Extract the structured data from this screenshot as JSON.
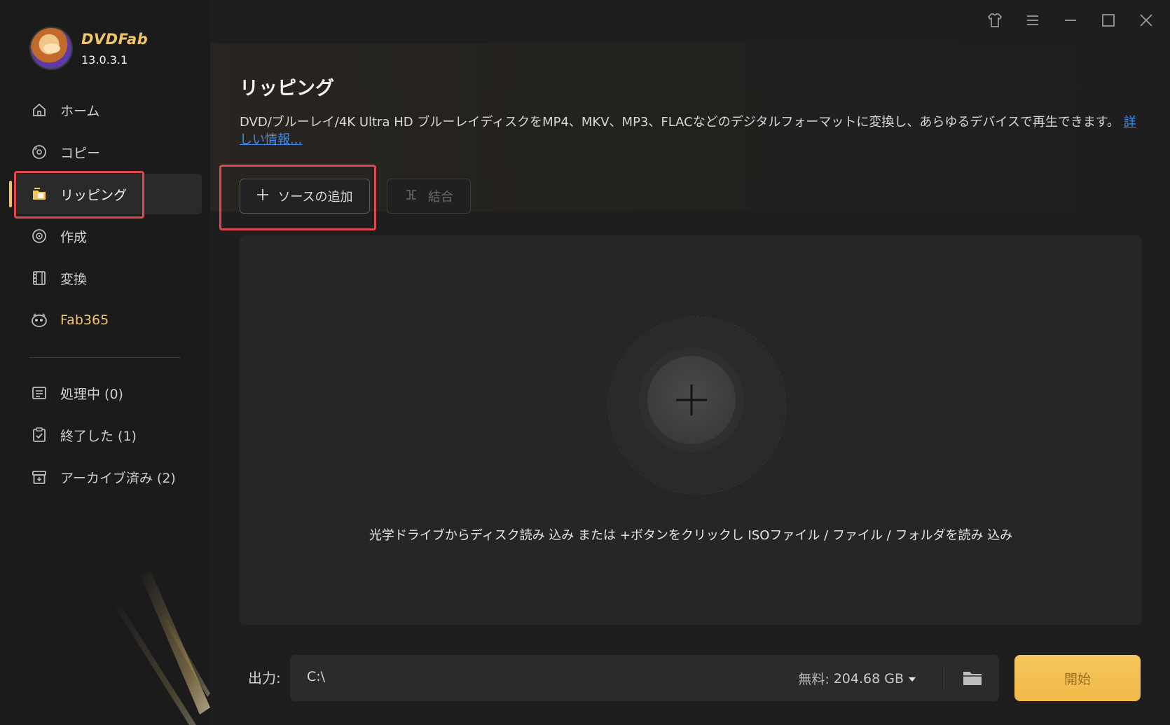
{
  "app": {
    "brand": "DVDFab",
    "version": "13.0.3.1"
  },
  "sidebar": {
    "items": [
      {
        "label": "ホーム",
        "icon": "home-icon"
      },
      {
        "label": "コピー",
        "icon": "disc-copy-icon"
      },
      {
        "label": "リッピング",
        "icon": "rip-icon",
        "active": true
      },
      {
        "label": "作成",
        "icon": "disc-create-icon"
      },
      {
        "label": "変換",
        "icon": "film-icon"
      },
      {
        "label": "Fab365",
        "icon": "fab365-icon"
      }
    ],
    "queue": [
      {
        "label": "処理中 (0)",
        "icon": "processing-list-icon"
      },
      {
        "label": "終了した (1)",
        "icon": "finished-clipboard-icon"
      },
      {
        "label": "アーカイブ済み (2)",
        "icon": "archive-box-icon"
      }
    ]
  },
  "main": {
    "title": "リッピング",
    "description": "DVD/ブルーレイ/4K Ultra HD ブルーレイディスクをMP4、MKV、MP3、FLACなどのデジタルフォーマットに変換し、あらゆるデバイスで再生できます。",
    "more_link": "詳しい情報...",
    "add_source_label": "ソースの追加",
    "merge_label": "結合",
    "drop_hint": "光学ドライブからディスク読み 込み または +ボタンをクリックし ISOファイル / ファイル / フォルダを読み 込み"
  },
  "output": {
    "label": "出力:",
    "path": "C:\\",
    "free_label": "無料:",
    "free_value": "204.68 GB",
    "start_label": "開始"
  },
  "colors": {
    "accent": "#f3c35f",
    "highlight_box": "#e0484e",
    "link": "#3d8cf0"
  }
}
